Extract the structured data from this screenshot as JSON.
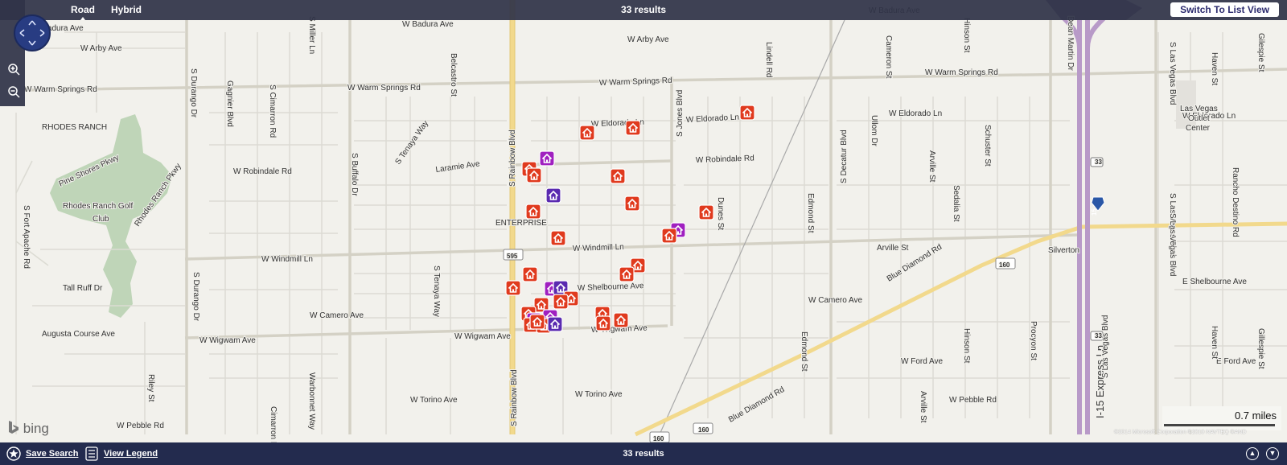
{
  "toolbar": {
    "tab_road": "Road",
    "tab_hybrid": "Hybrid",
    "results": "33 results",
    "switch_view": "Switch To List View"
  },
  "bottom": {
    "save_search": "Save Search",
    "view_legend": "View Legend",
    "results": "33 results"
  },
  "scale_label": "0.7 miles",
  "copyright": "©2014 Microsoft Corporation   ©2010 NAVTEQ   ©AND",
  "brand": "bing",
  "colors": {
    "marker_red": "#e03a1e",
    "marker_magenta": "#a020c0",
    "marker_purple": "#5a2ab0",
    "highway": "#b89ac8",
    "major_road": "#f2d98c"
  },
  "labels": [
    {
      "t": "W Badura Ave"
    },
    {
      "t": "W Badura Ave"
    },
    {
      "t": "W Badura Ave"
    },
    {
      "t": "W Arby Ave"
    },
    {
      "t": "W Arby Ave"
    },
    {
      "t": "W Warm Springs Rd"
    },
    {
      "t": "W Warm Springs Rd"
    },
    {
      "t": "W Warm Springs Rd"
    },
    {
      "t": "W Warm Springs Rd"
    },
    {
      "t": "RHODES RANCH"
    },
    {
      "t": "Pine Shores Pkwy"
    },
    {
      "t": "Rhodes Ranch Golf"
    },
    {
      "t": "Club"
    },
    {
      "t": "Rhodes Ranch Pkwy"
    },
    {
      "t": "W Robindale Rd"
    },
    {
      "t": "Laramie Ave"
    },
    {
      "t": "W Robindale Rd"
    },
    {
      "t": "W Eldorado Ln"
    },
    {
      "t": "W Eldorado Ln"
    },
    {
      "t": "W Eldorado Ln"
    },
    {
      "t": "W Eldorado Ln"
    },
    {
      "t": "ENTERPRISE"
    },
    {
      "t": "W Windmill Ln"
    },
    {
      "t": "W Windmill Ln"
    },
    {
      "t": "595"
    },
    {
      "t": "Tall Ruff Dr"
    },
    {
      "t": "W Camero Ave"
    },
    {
      "t": "W Camero Ave"
    },
    {
      "t": "Augusta Course Ave"
    },
    {
      "t": "W Wigwam Ave"
    },
    {
      "t": "W Wigwam Ave"
    },
    {
      "t": "W Wigwam Ave"
    },
    {
      "t": "W Torino Ave"
    },
    {
      "t": "W Torino Ave"
    },
    {
      "t": "W Pebble Rd"
    },
    {
      "t": "W Pebble Rd"
    },
    {
      "t": "W Shelbourne Ave"
    },
    {
      "t": "E Shelbourne Ave"
    },
    {
      "t": "Arville St"
    },
    {
      "t": "W Ford Ave"
    },
    {
      "t": "E Ford Ave"
    },
    {
      "t": "Blue Diamond Rd"
    },
    {
      "t": "Blue Diamond Rd"
    },
    {
      "t": "160"
    },
    {
      "t": "160"
    },
    {
      "t": "160"
    },
    {
      "t": "Silverton"
    },
    {
      "t": "Las Vegas"
    },
    {
      "t": "Outlet"
    },
    {
      "t": "Center"
    },
    {
      "t": "I-15 Express Ln"
    },
    {
      "t": "S Durango Dr"
    },
    {
      "t": "S Durango Dr"
    },
    {
      "t": "S Fort Apache Rd"
    },
    {
      "t": "Gagnier Blvd"
    },
    {
      "t": "S Cimarron Rd"
    },
    {
      "t": "S Miller Ln"
    },
    {
      "t": "Belcastro St"
    },
    {
      "t": "S Buffalo Dr"
    },
    {
      "t": "S Tenaya Way"
    },
    {
      "t": "S Tenaya Way"
    },
    {
      "t": "S Rainbow Blvd"
    },
    {
      "t": "S Rainbow Blvd"
    },
    {
      "t": "S Jones Blvd"
    },
    {
      "t": "Lindell Rd"
    },
    {
      "t": "Dunes St"
    },
    {
      "t": "Edmond St"
    },
    {
      "t": "Edmond St"
    },
    {
      "t": "S Decatur Blvd"
    },
    {
      "t": "Cameron St"
    },
    {
      "t": "Ullom Dr"
    },
    {
      "t": "Sedalia St"
    },
    {
      "t": "Arville St"
    },
    {
      "t": "Arville St"
    },
    {
      "t": "Schuster St"
    },
    {
      "t": "Hinson St"
    },
    {
      "t": "Hinson St"
    },
    {
      "t": "Procyon St"
    },
    {
      "t": "Dean Martin Dr"
    },
    {
      "t": "S Las Vegas Blvd"
    },
    {
      "t": "S Las Vegas Blvd"
    },
    {
      "t": "S Las Vegas Blvd"
    },
    {
      "t": "Haven St"
    },
    {
      "t": "Haven St"
    },
    {
      "t": "Gilespie St"
    },
    {
      "t": "Rancho Destino Rd"
    },
    {
      "t": "Riley St"
    },
    {
      "t": "Cimarron Rd"
    },
    {
      "t": "Warbonnet Way"
    },
    {
      "t": "Gillespie St"
    },
    {
      "t": "S Las Vegas Blvd"
    },
    {
      "t": "15"
    },
    {
      "t": "33"
    },
    {
      "t": "33"
    }
  ]
}
